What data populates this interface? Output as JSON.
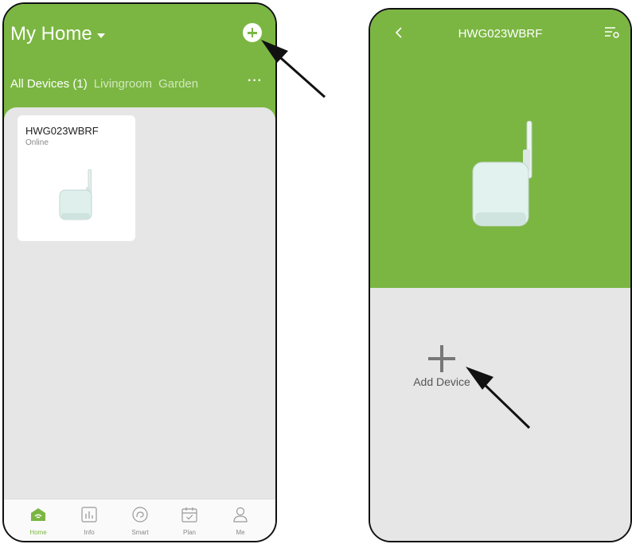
{
  "left_screen": {
    "home_title": "My Home",
    "tabs": [
      {
        "label": "All Devices (1)",
        "active": true
      },
      {
        "label": "Livingroom",
        "active": false
      },
      {
        "label": "Garden",
        "active": false
      }
    ],
    "more_label": "···",
    "device_card": {
      "name": "HWG023WBRF",
      "status": "Online"
    },
    "tabbar": [
      {
        "label": "Home",
        "icon": "home-icon",
        "active": true
      },
      {
        "label": "Info",
        "icon": "chart-icon",
        "active": false
      },
      {
        "label": "Smart",
        "icon": "smart-icon",
        "active": false
      },
      {
        "label": "Plan",
        "icon": "calendar-icon",
        "active": false
      },
      {
        "label": "Me",
        "icon": "person-icon",
        "active": false
      }
    ]
  },
  "right_screen": {
    "title": "HWG023WBRF",
    "add_device_label": "Add Device"
  },
  "colors": {
    "accent": "#7bb642",
    "background": "#e6e6e6"
  }
}
